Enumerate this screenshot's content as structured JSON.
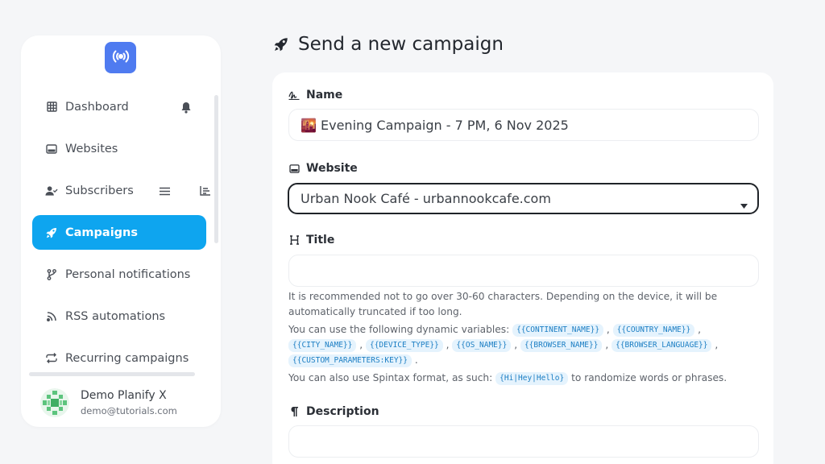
{
  "sidebar": {
    "logo_icon": "broadcast-icon",
    "items": [
      {
        "label": "Dashboard",
        "icon": "grid-icon"
      },
      {
        "label": "Websites",
        "icon": "window-icon"
      },
      {
        "label": "Subscribers",
        "icon": "user-check-icon"
      },
      {
        "label": "Campaigns",
        "icon": "rocket-icon",
        "active": true
      },
      {
        "label": "Personal notifications",
        "icon": "branch-icon"
      },
      {
        "label": "RSS automations",
        "icon": "rss-icon"
      },
      {
        "label": "Recurring campaigns",
        "icon": "repeat-icon"
      }
    ],
    "user": {
      "name": "Demo Planify X",
      "email": "demo@tutorials.com"
    }
  },
  "main": {
    "title": "Send a new campaign",
    "name_label": "Name",
    "name_value": "🌇 Evening Campaign - 7 PM, 6 Nov 2025",
    "website_label": "Website",
    "website_value": "Urban Nook Café - urbannookcafe.com",
    "title_label": "Title",
    "title_value": "",
    "help_chars": "It is recommended not to go over 30-60 characters. Depending on the device, it will be automatically truncated if too long.",
    "help_vars_prefix": "You can use the following dynamic variables:",
    "variables": [
      "{{CONTINENT_NAME}}",
      "{{COUNTRY_NAME}}",
      "{{CITY_NAME}}",
      "{{DEVICE_TYPE}}",
      "{{OS_NAME}}",
      "{{BROWSER_NAME}}",
      "{{BROWSER_LANGUAGE}}",
      "{{CUSTOM_PARAMETERS:KEY}}"
    ],
    "help_spintax_prefix": "You can also use Spintax format, as such:",
    "spintax_example": "{Hi|Hey|Hello}",
    "help_spintax_suffix": "to randomize words or phrases.",
    "description_label": "Description",
    "description_value": ""
  },
  "colors": {
    "accent": "#0ea5ef",
    "logo": "#4f7bf0",
    "tag_bg": "#e5f3fd",
    "tag_text": "#1d7fc4"
  }
}
